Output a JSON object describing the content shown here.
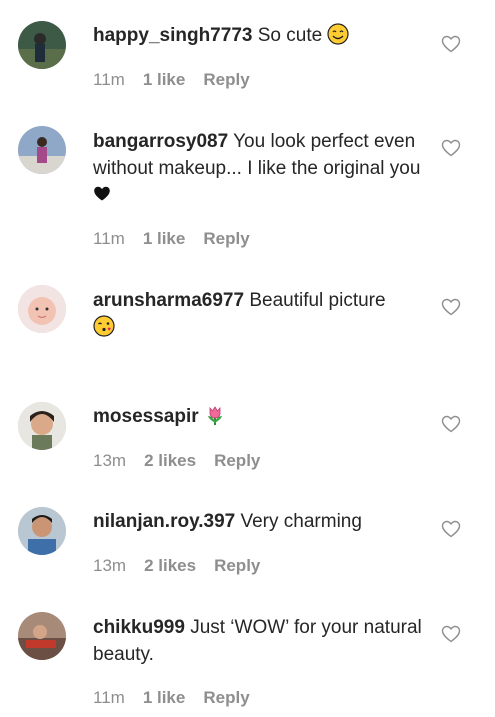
{
  "comments": [
    {
      "username": "happy_singh7773",
      "text": "So cute",
      "emoji": "smiling-face-icon",
      "time": "11m",
      "likes": "1 like",
      "reply": "Reply"
    },
    {
      "username": "bangarrosy087",
      "text": "You look perfect even without makeup... I like the original you",
      "emoji": "black-heart-icon",
      "time": "11m",
      "likes": "1 like",
      "reply": "Reply"
    },
    {
      "username": "arunsharma6977",
      "text": "Beautiful picture",
      "emoji": "face-blowing-kiss-icon"
    },
    {
      "username": "mosessapir",
      "text": "",
      "emoji": "tulip-icon",
      "time": "13m",
      "likes": "2 likes",
      "reply": "Reply"
    },
    {
      "username": "nilanjan.roy.397",
      "text": "Very charming",
      "time": "13m",
      "likes": "2 likes",
      "reply": "Reply"
    },
    {
      "username": "chikku999",
      "text": "Just ‘WOW’ for your natural beauty.",
      "time": "11m",
      "likes": "1 like",
      "reply": "Reply"
    }
  ],
  "colors": {
    "text": "#262626",
    "meta": "#8e8e8e",
    "heart_outline": "#8e8e8e"
  }
}
